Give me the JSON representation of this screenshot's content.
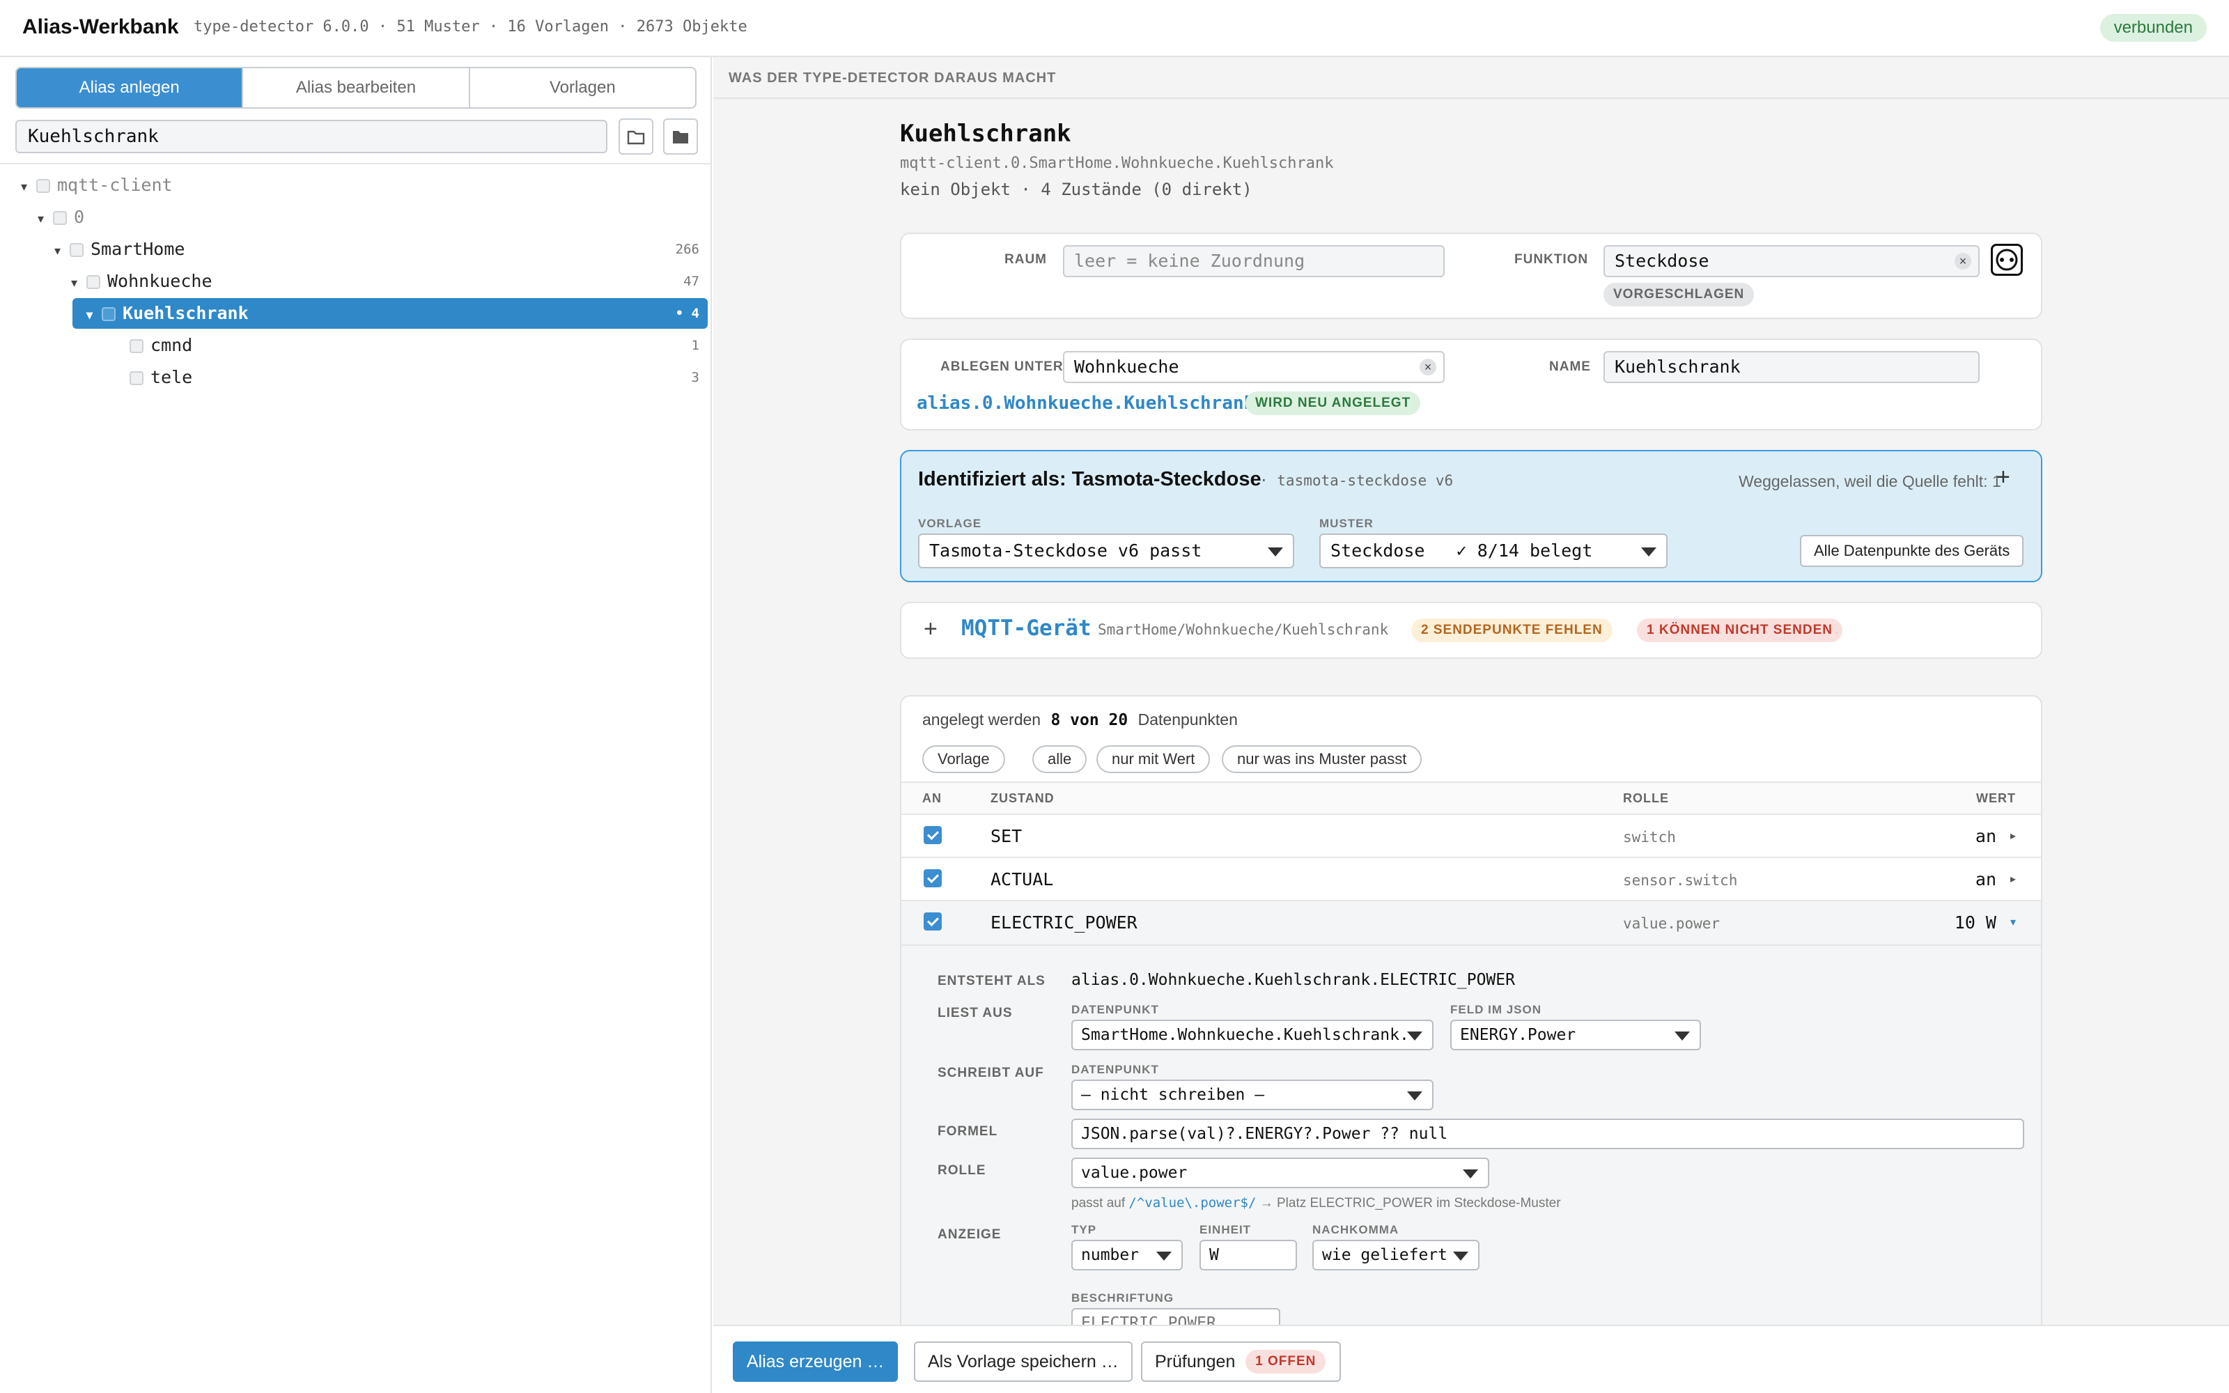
{
  "header": {
    "title": "Alias-Werkbank",
    "meta": "type-detector 6.0.0 · 51 Muster · 16 Vorlagen · 2673 Objekte",
    "status": "verbunden",
    "status_color": "#2b7a3d"
  },
  "left": {
    "tabs": [
      "Alias anlegen",
      "Alias bearbeiten",
      "Vorlagen"
    ],
    "active_tab": "Alias anlegen",
    "search_value": "Kuehlschrank",
    "tree": [
      {
        "label": "mqtt-client",
        "toggle": "▾",
        "count": ""
      },
      {
        "label": "0",
        "toggle": "▾",
        "count": ""
      },
      {
        "label": "SmartHome",
        "toggle": "▾",
        "count": "266"
      },
      {
        "label": "Wohnkueche",
        "toggle": "▾",
        "count": "47"
      },
      {
        "label": "Kuehlschrank",
        "toggle": "▾",
        "count": "• 4"
      },
      {
        "label": "cmnd",
        "toggle": "",
        "count": "1"
      },
      {
        "label": "tele",
        "toggle": "",
        "count": "3"
      }
    ]
  },
  "right": {
    "section_title": "WAS DER TYPE-DETECTOR DARAUS MACHT",
    "object": {
      "title": "Kuehlschrank",
      "path": "mqtt-client.0.SmartHome.Wohnkueche.Kuehlschrank",
      "info": "kein Objekt · 4 Zustände (0 direkt)"
    },
    "raum": {
      "label": "RAUM",
      "placeholder": "leer = keine Zuordnung"
    },
    "funktion": {
      "label": "FUNKTION",
      "value": "Steckdose",
      "badge": "VORGESCHLAGEN"
    },
    "ablegen": {
      "label": "ABLEGEN UNTER",
      "value": "Wohnkueche",
      "id": "alias.0.Wohnkueche.Kuehlschrank",
      "badge": "WIRD NEU ANGELEGT"
    },
    "name": {
      "label": "NAME",
      "value": "Kuehlschrank"
    },
    "ident": {
      "title": "Identifiziert als: Tasmota-Steckdose",
      "sub": "· tasmota-steckdose v6",
      "omitted": "Weggelassen, weil die Quelle fehlt: 1",
      "plus": "+",
      "vorlage_label": "VORLAGE",
      "vorlage_value": "Tasmota-Steckdose v6 passt",
      "muster_label": "MUSTER",
      "muster_value": "Steckdose   ✓ 8/14 belegt",
      "all_button": "Alle Datenpunkte des Geräts"
    },
    "mqtt": {
      "plus": "+",
      "title": "MQTT-Gerät",
      "path": "SmartHome/Wohnkueche/Kuehlschrank",
      "warn1": "2 SENDEPUNKTE FEHLEN",
      "warn2": "1 KÖNNEN NICHT SENDEN"
    },
    "dp": {
      "prefix": "angelegt werden",
      "count": "8 von 20",
      "suffix": "Datenpunkten",
      "filters": [
        "Vorlage",
        "alle",
        "nur mit Wert",
        "nur was ins Muster passt"
      ],
      "columns": {
        "an": "AN",
        "zustand": "ZUSTAND",
        "rolle": "ROLLE",
        "wert": "WERT"
      },
      "rows": [
        {
          "name": "SET",
          "role": "switch",
          "value": "an",
          "arrow": "▸"
        },
        {
          "name": "ACTUAL",
          "role": "sensor.switch",
          "value": "an",
          "arrow": "▸"
        },
        {
          "name": "ELECTRIC_POWER",
          "role": "value.power",
          "value": "10 W",
          "arrow": "▾"
        }
      ]
    },
    "detail": {
      "entsteht_label": "ENTSTEHT ALS",
      "entsteht_value": "alias.0.Wohnkueche.Kuehlschrank.ELECTRIC_POWER",
      "liest_label": "LIEST AUS",
      "datenpunkt_label": "DATENPUNKT",
      "liest_dp": "SmartHome.Wohnkueche.Kuehlschrank.",
      "feld_label": "FELD IM JSON",
      "feld_value": "ENERGY.Power",
      "schreibt_label": "SCHREIBT AUF",
      "schreibt_dp_label": "DATENPUNKT",
      "schreibt_value": "– nicht schreiben –",
      "formel_label": "FORMEL",
      "formel_value": "JSON.parse(val)?.ENERGY?.Power ?? null",
      "rolle_label": "ROLLE",
      "rolle_value": "value.power",
      "hint_prefix": "passt auf",
      "hint_regex": "/^value\\.power$/",
      "hint_suffix": "→ Platz ELECTRIC_POWER im Steckdose-Muster",
      "anzeige_label": "ANZEIGE",
      "typ_label": "TYP",
      "typ_value": "number",
      "einheit_label": "EINHEIT",
      "einheit_value": "W",
      "nachkomma_label": "NACHKOMMA",
      "nachkomma_value": "wie geliefert",
      "beschriftung_label": "BESCHRIFTUNG",
      "beschriftung_value": "ELECTRIC_POWER"
    },
    "footer": {
      "create": "Alias erzeugen …",
      "save_template": "Als Vorlage speichern …",
      "checks": "Prüfungen",
      "checks_badge": "1 OFFEN"
    }
  },
  "colors": {
    "accent": "#3b8fd0",
    "ident_bg": "#dbeef8",
    "ok_green": "#2b7a3d",
    "warn_orange": "#b5651d",
    "error_red": "#c0392b"
  }
}
